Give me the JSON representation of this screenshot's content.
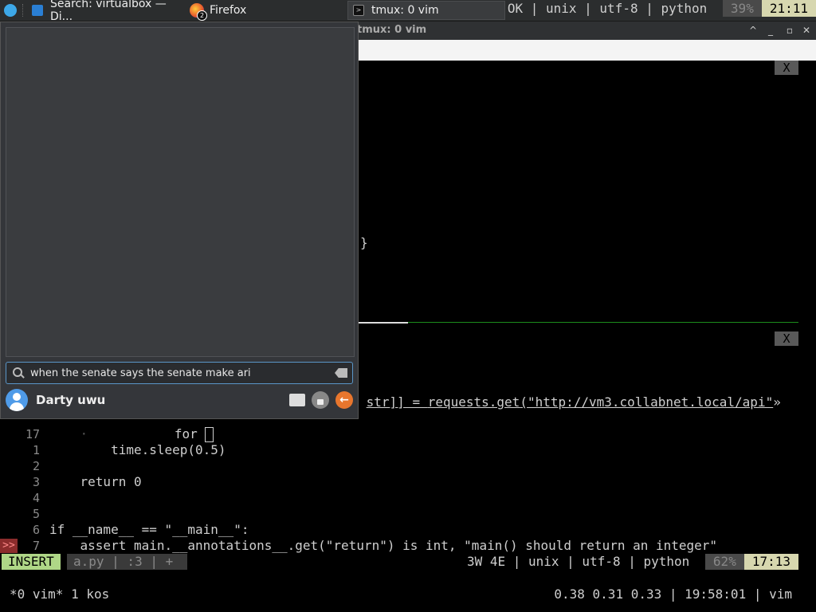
{
  "taskbar": {
    "tasks": [
      {
        "label": "Search: virtualbox — Di...",
        "icon": "dolphin-icon"
      },
      {
        "label": "Firefox",
        "icon": "firefox-icon",
        "badge": "2"
      },
      {
        "label": "tmux: 0 vim",
        "icon": "terminal-icon"
      }
    ]
  },
  "window": {
    "title": "tmux: 0 vim",
    "controls": {
      "minimize": "^",
      "maximize": "_",
      "restore": "▫",
      "close": "✕"
    }
  },
  "terminal": {
    "close_label": "X",
    "top_pane": {
      "brace": "}",
      "status": {
        "info": "OK | unix | utf-8 | python ",
        "percent": "39%",
        "position": "21:11"
      }
    },
    "bottom_pane": {
      "request_line": {
        "pre": " ",
        "str": "str",
        "mid": "]] = ",
        "call": "requests.get",
        "paren": "(",
        "url": "\"http://vm3.collabnet.local/api\"",
        "more": "»"
      },
      "lines": [
        {
          "num": "17",
          "code": "        for "
        },
        {
          "num": "1",
          "code": "        time.sleep(0.5)"
        },
        {
          "num": "2",
          "code": ""
        },
        {
          "num": "3",
          "code": "    return 0"
        },
        {
          "num": "4",
          "code": ""
        },
        {
          "num": "5",
          "code": ""
        },
        {
          "num": "6",
          "code": "if __name__ == \"__main__\":"
        },
        {
          "num": "7",
          "code": "    assert main.__annotations__.get(\"return\") is int, \"main() should return an integer\""
        }
      ],
      "sign": ">>",
      "status": {
        "mode": "INSERT",
        "file": "a.py | :3 | + ",
        "info": "3W 4E | unix | utf-8 | python ",
        "percent": "62%",
        "position": "17:13"
      }
    },
    "tmux": {
      "left": "*0 vim* 1 kos",
      "right": "0.38 0.31 0.33 | 19:58:01 | vim"
    }
  },
  "launcher": {
    "search": {
      "value": "when the senate says the senate make ari"
    },
    "user": {
      "name": "Darty uwu"
    }
  }
}
